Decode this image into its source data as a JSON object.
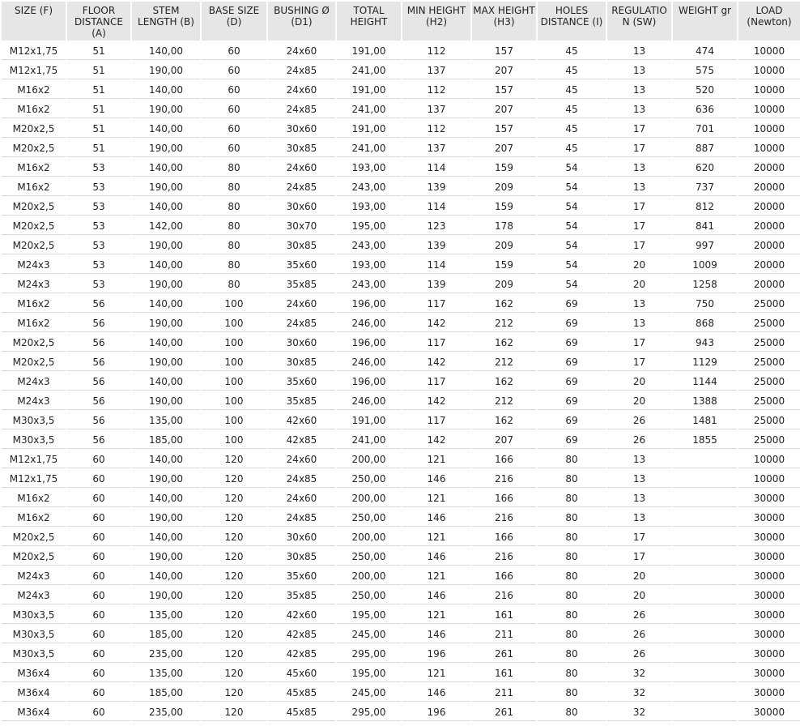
{
  "table": {
    "headers": [
      "SIZE (F)",
      "FLOOR DISTANCE (A)",
      "STEM LENGTH (B)",
      "BASE SIZE (D)",
      "BUSHING Ø (D1)",
      "TOTAL HEIGHT",
      "MIN HEIGHT (H2)",
      "MAX HEIGHT (H3)",
      "HOLES DISTANCE (I)",
      "REGULATIO N (SW)",
      "WEIGHT gr",
      "LOAD (Newton)"
    ],
    "rows": [
      [
        "M12x1,75",
        "51",
        "140,00",
        "60",
        "24x60",
        "191,00",
        "112",
        "157",
        "45",
        "13",
        "474",
        "10000"
      ],
      [
        "M12x1,75",
        "51",
        "190,00",
        "60",
        "24x85",
        "241,00",
        "137",
        "207",
        "45",
        "13",
        "575",
        "10000"
      ],
      [
        "M16x2",
        "51",
        "140,00",
        "60",
        "24x60",
        "191,00",
        "112",
        "157",
        "45",
        "13",
        "520",
        "10000"
      ],
      [
        "M16x2",
        "51",
        "190,00",
        "60",
        "24x85",
        "241,00",
        "137",
        "207",
        "45",
        "13",
        "636",
        "10000"
      ],
      [
        "M20x2,5",
        "51",
        "140,00",
        "60",
        "30x60",
        "191,00",
        "112",
        "157",
        "45",
        "17",
        "701",
        "10000"
      ],
      [
        "M20x2,5",
        "51",
        "190,00",
        "60",
        "30x85",
        "241,00",
        "137",
        "207",
        "45",
        "17",
        "887",
        "10000"
      ],
      [
        "M16x2",
        "53",
        "140,00",
        "80",
        "24x60",
        "193,00",
        "114",
        "159",
        "54",
        "13",
        "620",
        "20000"
      ],
      [
        "M16x2",
        "53",
        "190,00",
        "80",
        "24x85",
        "243,00",
        "139",
        "209",
        "54",
        "13",
        "737",
        "20000"
      ],
      [
        "M20x2,5",
        "53",
        "140,00",
        "80",
        "30x60",
        "193,00",
        "114",
        "159",
        "54",
        "17",
        "812",
        "20000"
      ],
      [
        "M20x2,5",
        "53",
        "142,00",
        "80",
        "30x70",
        "195,00",
        "123",
        "178",
        "54",
        "17",
        "841",
        "20000"
      ],
      [
        "M20x2,5",
        "53",
        "190,00",
        "80",
        "30x85",
        "243,00",
        "139",
        "209",
        "54",
        "17",
        "997",
        "20000"
      ],
      [
        "M24x3",
        "53",
        "140,00",
        "80",
        "35x60",
        "193,00",
        "114",
        "159",
        "54",
        "20",
        "1009",
        "20000"
      ],
      [
        "M24x3",
        "53",
        "190,00",
        "80",
        "35x85",
        "243,00",
        "139",
        "209",
        "54",
        "20",
        "1258",
        "20000"
      ],
      [
        "M16x2",
        "56",
        "140,00",
        "100",
        "24x60",
        "196,00",
        "117",
        "162",
        "69",
        "13",
        "750",
        "25000"
      ],
      [
        "M16x2",
        "56",
        "190,00",
        "100",
        "24x85",
        "246,00",
        "142",
        "212",
        "69",
        "13",
        "868",
        "25000"
      ],
      [
        "M20x2,5",
        "56",
        "140,00",
        "100",
        "30x60",
        "196,00",
        "117",
        "162",
        "69",
        "17",
        "943",
        "25000"
      ],
      [
        "M20x2,5",
        "56",
        "190,00",
        "100",
        "30x85",
        "246,00",
        "142",
        "212",
        "69",
        "17",
        "1129",
        "25000"
      ],
      [
        "M24x3",
        "56",
        "140,00",
        "100",
        "35x60",
        "196,00",
        "117",
        "162",
        "69",
        "20",
        "1144",
        "25000"
      ],
      [
        "M24x3",
        "56",
        "190,00",
        "100",
        "35x85",
        "246,00",
        "142",
        "212",
        "69",
        "20",
        "1388",
        "25000"
      ],
      [
        "M30x3,5",
        "56",
        "135,00",
        "100",
        "42x60",
        "191,00",
        "117",
        "162",
        "69",
        "26",
        "1481",
        "25000"
      ],
      [
        "M30x3,5",
        "56",
        "185,00",
        "100",
        "42x85",
        "241,00",
        "142",
        "207",
        "69",
        "26",
        "1855",
        "25000"
      ],
      [
        "M12x1,75",
        "60",
        "140,00",
        "120",
        "24x60",
        "200,00",
        "121",
        "166",
        "80",
        "13",
        "",
        "10000"
      ],
      [
        "M12x1,75",
        "60",
        "190,00",
        "120",
        "24x85",
        "250,00",
        "146",
        "216",
        "80",
        "13",
        "",
        "10000"
      ],
      [
        "M16x2",
        "60",
        "140,00",
        "120",
        "24x60",
        "200,00",
        "121",
        "166",
        "80",
        "13",
        "",
        "30000"
      ],
      [
        "M16x2",
        "60",
        "190,00",
        "120",
        "24x85",
        "250,00",
        "146",
        "216",
        "80",
        "13",
        "",
        "30000"
      ],
      [
        "M20x2,5",
        "60",
        "140,00",
        "120",
        "30x60",
        "200,00",
        "121",
        "166",
        "80",
        "17",
        "",
        "30000"
      ],
      [
        "M20x2,5",
        "60",
        "190,00",
        "120",
        "30x85",
        "250,00",
        "146",
        "216",
        "80",
        "17",
        "",
        "30000"
      ],
      [
        "M24x3",
        "60",
        "140,00",
        "120",
        "35x60",
        "200,00",
        "121",
        "166",
        "80",
        "20",
        "",
        "30000"
      ],
      [
        "M24x3",
        "60",
        "190,00",
        "120",
        "35x85",
        "250,00",
        "146",
        "216",
        "80",
        "20",
        "",
        "30000"
      ],
      [
        "M30x3,5",
        "60",
        "135,00",
        "120",
        "42x60",
        "195,00",
        "121",
        "161",
        "80",
        "26",
        "",
        "30000"
      ],
      [
        "M30x3,5",
        "60",
        "185,00",
        "120",
        "42x85",
        "245,00",
        "146",
        "211",
        "80",
        "26",
        "",
        "30000"
      ],
      [
        "M30x3,5",
        "60",
        "235,00",
        "120",
        "42x85",
        "295,00",
        "196",
        "261",
        "80",
        "26",
        "",
        "30000"
      ],
      [
        "M36x4",
        "60",
        "135,00",
        "120",
        "45x60",
        "195,00",
        "121",
        "161",
        "80",
        "32",
        "",
        "30000"
      ],
      [
        "M36x4",
        "60",
        "185,00",
        "120",
        "45x85",
        "245,00",
        "146",
        "211",
        "80",
        "32",
        "",
        "30000"
      ],
      [
        "M36x4",
        "60",
        "235,00",
        "120",
        "45x85",
        "295,00",
        "196",
        "261",
        "80",
        "32",
        "",
        "30000"
      ]
    ]
  }
}
